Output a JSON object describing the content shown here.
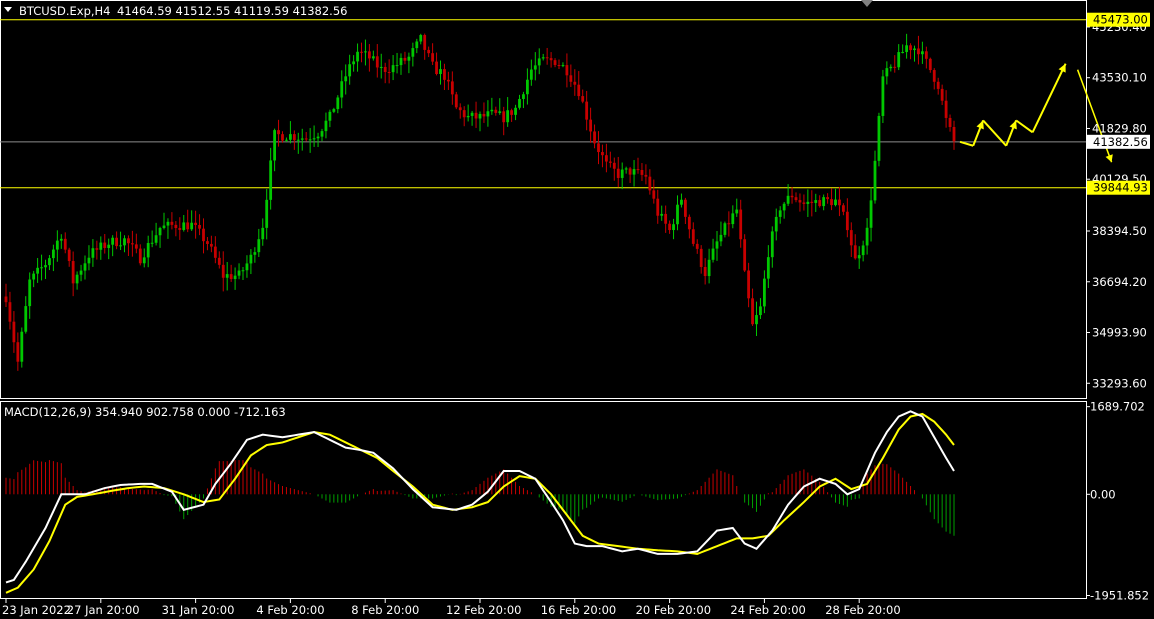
{
  "header": {
    "symbol_timeframe": "BTCUSD.Exp,H4",
    "ohlc": "41464.59 41512.55 41119.59 41382.56"
  },
  "macd_header": "MACD(12,26,9) 354.940 902.758 0.000 -712.163",
  "colors": {
    "background": "#000000",
    "bull_candle": "#00c800",
    "bear_candle": "#c80000",
    "level_line": "#ffff00",
    "bid_line": "#a0a0a0",
    "macd_main": "#ffffff",
    "macd_signal": "#ffff00",
    "hist_pos": "#c80000",
    "hist_neg": "#00a000",
    "axis": "#ffffff"
  },
  "levels": {
    "resistance": "45473.00",
    "support": "39844.93",
    "bid": "41382.56"
  },
  "chart_data": [
    {
      "type": "candlestick",
      "title": "BTCUSD.Exp,H4",
      "ylim": [
        32800,
        46100
      ],
      "price_ticks": [
        "45230.40",
        "43530.10",
        "41829.80",
        "40129.50",
        "38394.50",
        "36694.20",
        "34993.90",
        "33293.60"
      ],
      "price_tick_values": [
        45230.4,
        43530.1,
        41829.8,
        40129.5,
        38394.5,
        36694.2,
        34993.9,
        33293.6
      ],
      "x_ticks": [
        "23 Jan 2022",
        "27 Jan 20:00",
        "31 Jan 20:00",
        "4 Feb 20:00",
        "8 Feb 20:00",
        "12 Feb 20:00",
        "16 Feb 20:00",
        "20 Feb 20:00",
        "24 Feb 20:00",
        "28 Feb 20:00"
      ],
      "anchors": [
        [
          0,
          36200
        ],
        [
          3,
          34000
        ],
        [
          6,
          36700
        ],
        [
          10,
          37300
        ],
        [
          14,
          38300
        ],
        [
          17,
          36700
        ],
        [
          21,
          37600
        ],
        [
          26,
          38000
        ],
        [
          30,
          38100
        ],
        [
          34,
          37500
        ],
        [
          39,
          38500
        ],
        [
          43,
          38600
        ],
        [
          47,
          38600
        ],
        [
          51,
          38000
        ],
        [
          55,
          36900
        ],
        [
          59,
          36900
        ],
        [
          62,
          37500
        ],
        [
          65,
          38600
        ],
        [
          68,
          41600
        ],
        [
          72,
          41600
        ],
        [
          76,
          41500
        ],
        [
          79,
          41700
        ],
        [
          82,
          42200
        ],
        [
          86,
          43600
        ],
        [
          89,
          44400
        ],
        [
          92,
          44200
        ],
        [
          95,
          43800
        ],
        [
          98,
          43900
        ],
        [
          102,
          44200
        ],
        [
          105,
          44800
        ],
        [
          108,
          43900
        ],
        [
          111,
          43600
        ],
        [
          114,
          42500
        ],
        [
          117,
          42200
        ],
        [
          120,
          42200
        ],
        [
          123,
          42300
        ],
        [
          126,
          42200
        ],
        [
          129,
          42500
        ],
        [
          133,
          43800
        ],
        [
          136,
          44100
        ],
        [
          139,
          44100
        ],
        [
          142,
          43800
        ],
        [
          145,
          43100
        ],
        [
          149,
          41400
        ],
        [
          152,
          40600
        ],
        [
          155,
          40300
        ],
        [
          158,
          40400
        ],
        [
          162,
          40200
        ],
        [
          165,
          39000
        ],
        [
          168,
          38400
        ],
        [
          171,
          39500
        ],
        [
          174,
          38000
        ],
        [
          177,
          37000
        ],
        [
          180,
          38000
        ],
        [
          183,
          38700
        ],
        [
          185,
          39100
        ],
        [
          187,
          36900
        ],
        [
          189,
          35200
        ],
        [
          191,
          35800
        ],
        [
          193,
          37700
        ],
        [
          196,
          39200
        ],
        [
          199,
          39600
        ],
        [
          202,
          39300
        ],
        [
          206,
          39400
        ],
        [
          210,
          39400
        ],
        [
          213,
          38600
        ],
        [
          215,
          37400
        ],
        [
          218,
          38400
        ],
        [
          220,
          40700
        ],
        [
          222,
          43500
        ],
        [
          225,
          44000
        ],
        [
          228,
          44600
        ],
        [
          231,
          44500
        ],
        [
          234,
          43800
        ],
        [
          236,
          43300
        ],
        [
          238,
          42100
        ],
        [
          240,
          41382
        ]
      ],
      "candle_count": 241,
      "forecast_path": [
        [
          41382,
          0
        ],
        [
          41250,
          4
        ],
        [
          42100,
          7
        ],
        [
          41250,
          14
        ],
        [
          42100,
          17
        ],
        [
          41700,
          22
        ],
        [
          44000,
          32
        ]
      ]
    },
    {
      "type": "macd",
      "title": "MACD(12,26,9)",
      "series": [
        {
          "name": "MACD",
          "values_hint": "main line"
        },
        {
          "name": "Signal",
          "values_hint": "signal line"
        }
      ],
      "ylim": [
        -2000,
        1780
      ],
      "ticks": [
        "1689.702",
        "0.00",
        "-1951.852"
      ],
      "tick_values": [
        1689.702,
        0,
        -1951.852
      ],
      "main_anchors": [
        [
          0,
          -1700
        ],
        [
          2,
          -1650
        ],
        [
          5,
          -1300
        ],
        [
          10,
          -650
        ],
        [
          14,
          0
        ],
        [
          17,
          0
        ],
        [
          20,
          0
        ],
        [
          25,
          120
        ],
        [
          29,
          180
        ],
        [
          34,
          200
        ],
        [
          37,
          200
        ],
        [
          42,
          50
        ],
        [
          45,
          -300
        ],
        [
          50,
          -200
        ],
        [
          53,
          200
        ],
        [
          57,
          600
        ],
        [
          61,
          1050
        ],
        [
          65,
          1150
        ],
        [
          70,
          1100
        ],
        [
          74,
          1150
        ],
        [
          78,
          1200
        ],
        [
          82,
          1050
        ],
        [
          86,
          900
        ],
        [
          90,
          850
        ],
        [
          93,
          800
        ],
        [
          98,
          500
        ],
        [
          103,
          100
        ],
        [
          108,
          -250
        ],
        [
          114,
          -300
        ],
        [
          118,
          -200
        ],
        [
          122,
          50
        ],
        [
          126,
          450
        ],
        [
          130,
          450
        ],
        [
          134,
          300
        ],
        [
          138,
          -150
        ],
        [
          141,
          -500
        ],
        [
          144,
          -950
        ],
        [
          147,
          -1000
        ],
        [
          151,
          -1000
        ],
        [
          156,
          -1100
        ],
        [
          160,
          -1050
        ],
        [
          165,
          -1150
        ],
        [
          170,
          -1150
        ],
        [
          175,
          -1100
        ],
        [
          180,
          -700
        ],
        [
          184,
          -650
        ],
        [
          187,
          -950
        ],
        [
          190,
          -1050
        ],
        [
          194,
          -700
        ],
        [
          198,
          -200
        ],
        [
          202,
          150
        ],
        [
          206,
          300
        ],
        [
          210,
          200
        ],
        [
          213,
          0
        ],
        [
          216,
          100
        ],
        [
          220,
          800
        ],
        [
          223,
          1200
        ],
        [
          226,
          1500
        ],
        [
          229,
          1600
        ],
        [
          232,
          1500
        ],
        [
          235,
          1100
        ],
        [
          238,
          700
        ],
        [
          240,
          450
        ]
      ],
      "signal_anchors": [
        [
          0,
          -1900
        ],
        [
          3,
          -1800
        ],
        [
          7,
          -1450
        ],
        [
          11,
          -900
        ],
        [
          15,
          -200
        ],
        [
          18,
          -50
        ],
        [
          22,
          0
        ],
        [
          27,
          70
        ],
        [
          31,
          120
        ],
        [
          35,
          150
        ],
        [
          40,
          120
        ],
        [
          45,
          0
        ],
        [
          50,
          -150
        ],
        [
          54,
          -100
        ],
        [
          58,
          300
        ],
        [
          62,
          750
        ],
        [
          66,
          950
        ],
        [
          70,
          1000
        ],
        [
          74,
          1100
        ],
        [
          78,
          1200
        ],
        [
          82,
          1150
        ],
        [
          86,
          1000
        ],
        [
          90,
          850
        ],
        [
          94,
          700
        ],
        [
          98,
          450
        ],
        [
          103,
          150
        ],
        [
          108,
          -200
        ],
        [
          113,
          -300
        ],
        [
          118,
          -250
        ],
        [
          122,
          -150
        ],
        [
          126,
          150
        ],
        [
          130,
          350
        ],
        [
          134,
          300
        ],
        [
          138,
          0
        ],
        [
          142,
          -400
        ],
        [
          146,
          -800
        ],
        [
          150,
          -950
        ],
        [
          155,
          -1000
        ],
        [
          160,
          -1050
        ],
        [
          165,
          -1080
        ],
        [
          170,
          -1100
        ],
        [
          175,
          -1150
        ],
        [
          180,
          -1000
        ],
        [
          185,
          -850
        ],
        [
          189,
          -850
        ],
        [
          193,
          -800
        ],
        [
          197,
          -500
        ],
        [
          202,
          -150
        ],
        [
          206,
          150
        ],
        [
          210,
          300
        ],
        [
          214,
          100
        ],
        [
          218,
          200
        ],
        [
          222,
          700
        ],
        [
          226,
          1250
        ],
        [
          229,
          1500
        ],
        [
          232,
          1550
        ],
        [
          235,
          1400
        ],
        [
          238,
          1150
        ],
        [
          240,
          950
        ]
      ]
    }
  ]
}
